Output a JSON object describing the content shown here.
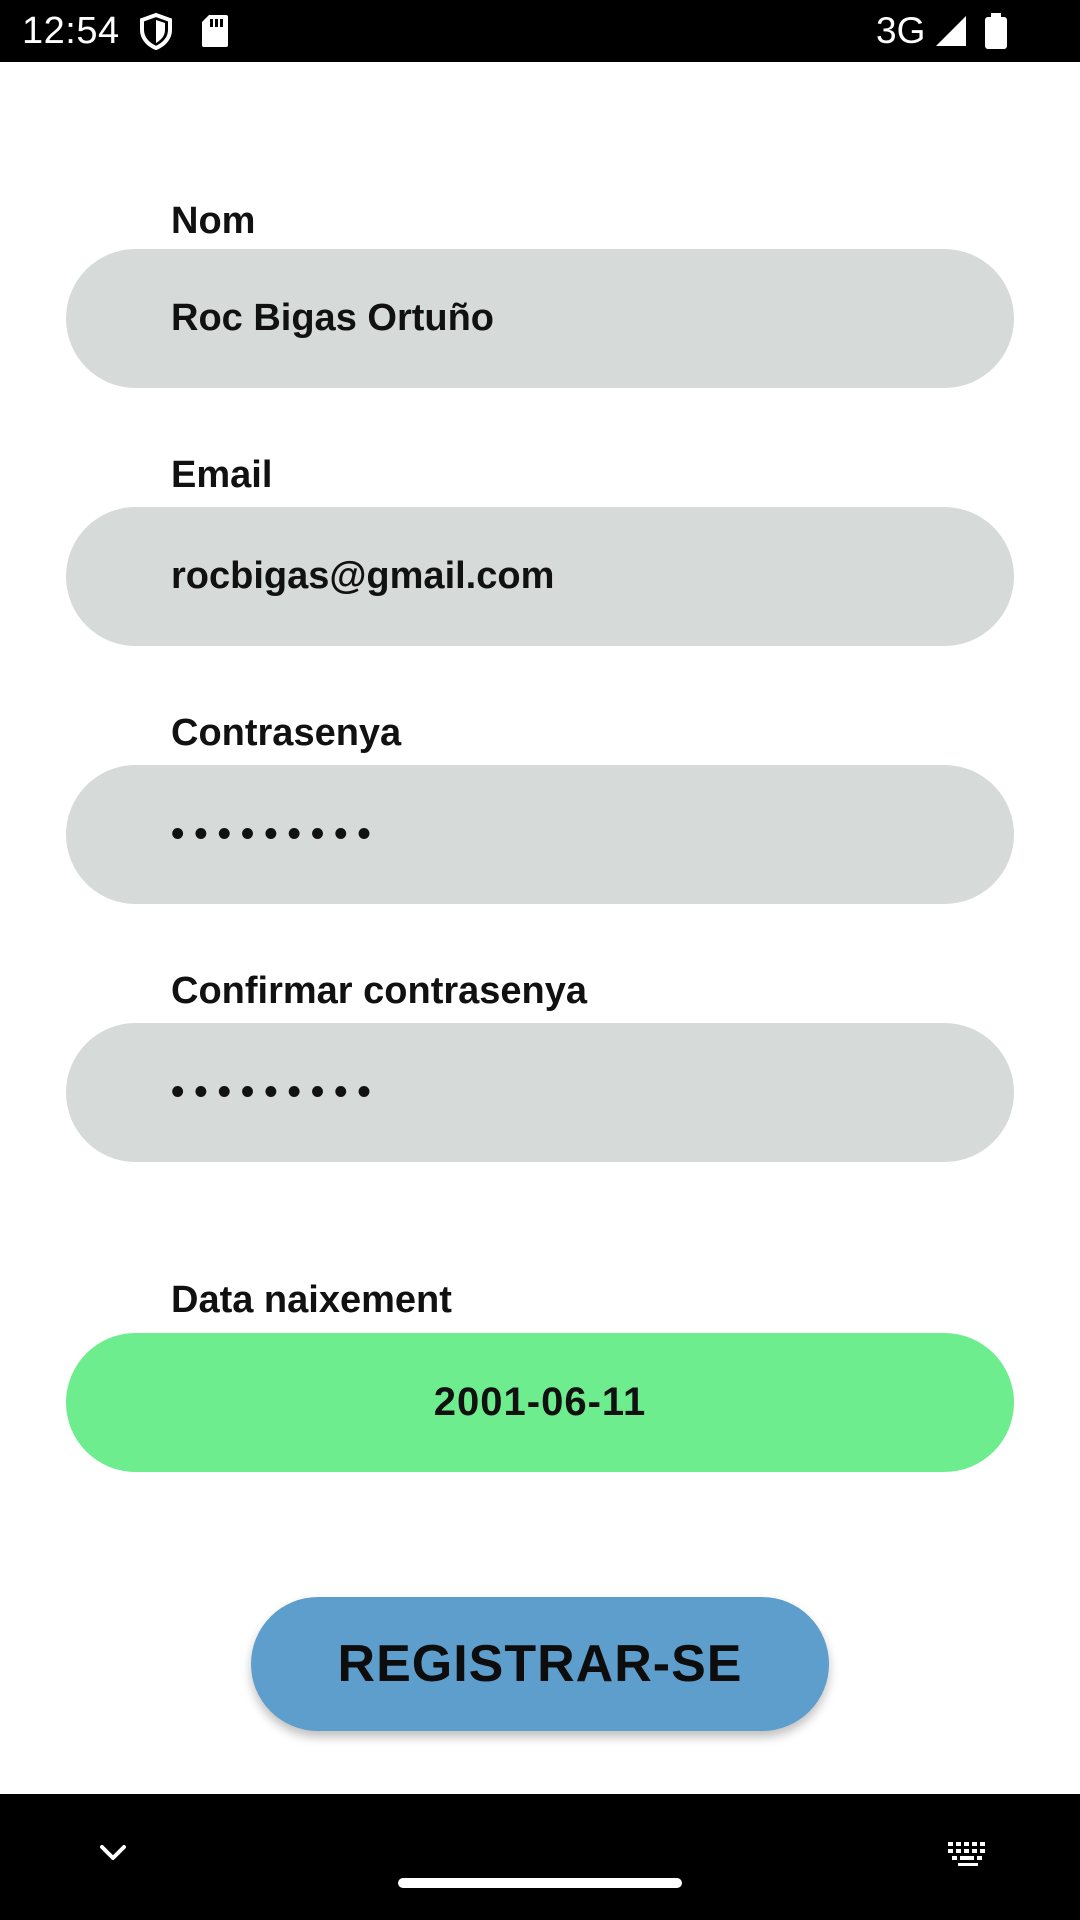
{
  "status_bar": {
    "time": "12:54",
    "network": "3G",
    "icons": [
      "shield-icon",
      "sd-card-icon",
      "signal-icon",
      "battery-icon"
    ]
  },
  "form": {
    "name": {
      "label": "Nom",
      "value": "Roc Bigas Ortuño"
    },
    "email": {
      "label": "Email",
      "value": "rocbigas@gmail.com"
    },
    "password": {
      "label": "Contrasenya",
      "masked_value": "•••••••••"
    },
    "confirm_password": {
      "label": "Confirmar contrasenya",
      "masked_value": "•••••••••"
    },
    "birth_date": {
      "label": "Data naixement",
      "value": "2001-06-11"
    },
    "submit_label": "REGISTRAR-SE"
  },
  "nav_bar": {
    "icons": [
      "chevron-down-icon",
      "home-handle",
      "keyboard-icon"
    ]
  },
  "colors": {
    "field_background": "#d6dad8",
    "date_background": "#6eed8e",
    "button_background": "#5e9ecd",
    "status_bar_background": "#000000"
  }
}
